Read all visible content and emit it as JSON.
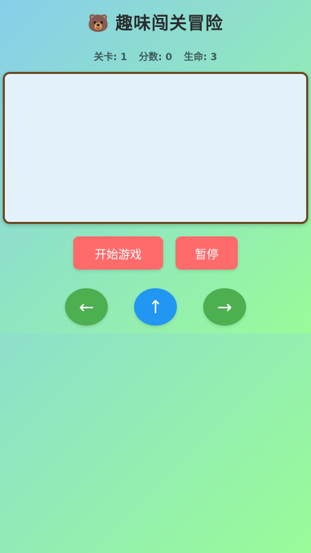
{
  "title": {
    "emoji": "🐻",
    "text": "趣味闯关冒险"
  },
  "stats": {
    "level_label": "关卡:",
    "level": "1",
    "score_label": "分数:",
    "score": "0",
    "lives_label": "生命:",
    "lives": "3"
  },
  "buttons": {
    "start": "开始游戏",
    "pause": "暂停"
  },
  "controls": {
    "left": "←",
    "jump": "↑",
    "right": "→"
  },
  "colors": {
    "accent_red": "#ff6b6b",
    "control_green": "#4caf50",
    "control_blue": "#2196f3",
    "game_area_bg": "#e3f1fb",
    "game_area_border": "#6b4a24"
  },
  "icons": {
    "title": "bear-face-icon",
    "left": "arrow-left-icon",
    "jump": "arrow-up-icon",
    "right": "arrow-right-icon"
  }
}
